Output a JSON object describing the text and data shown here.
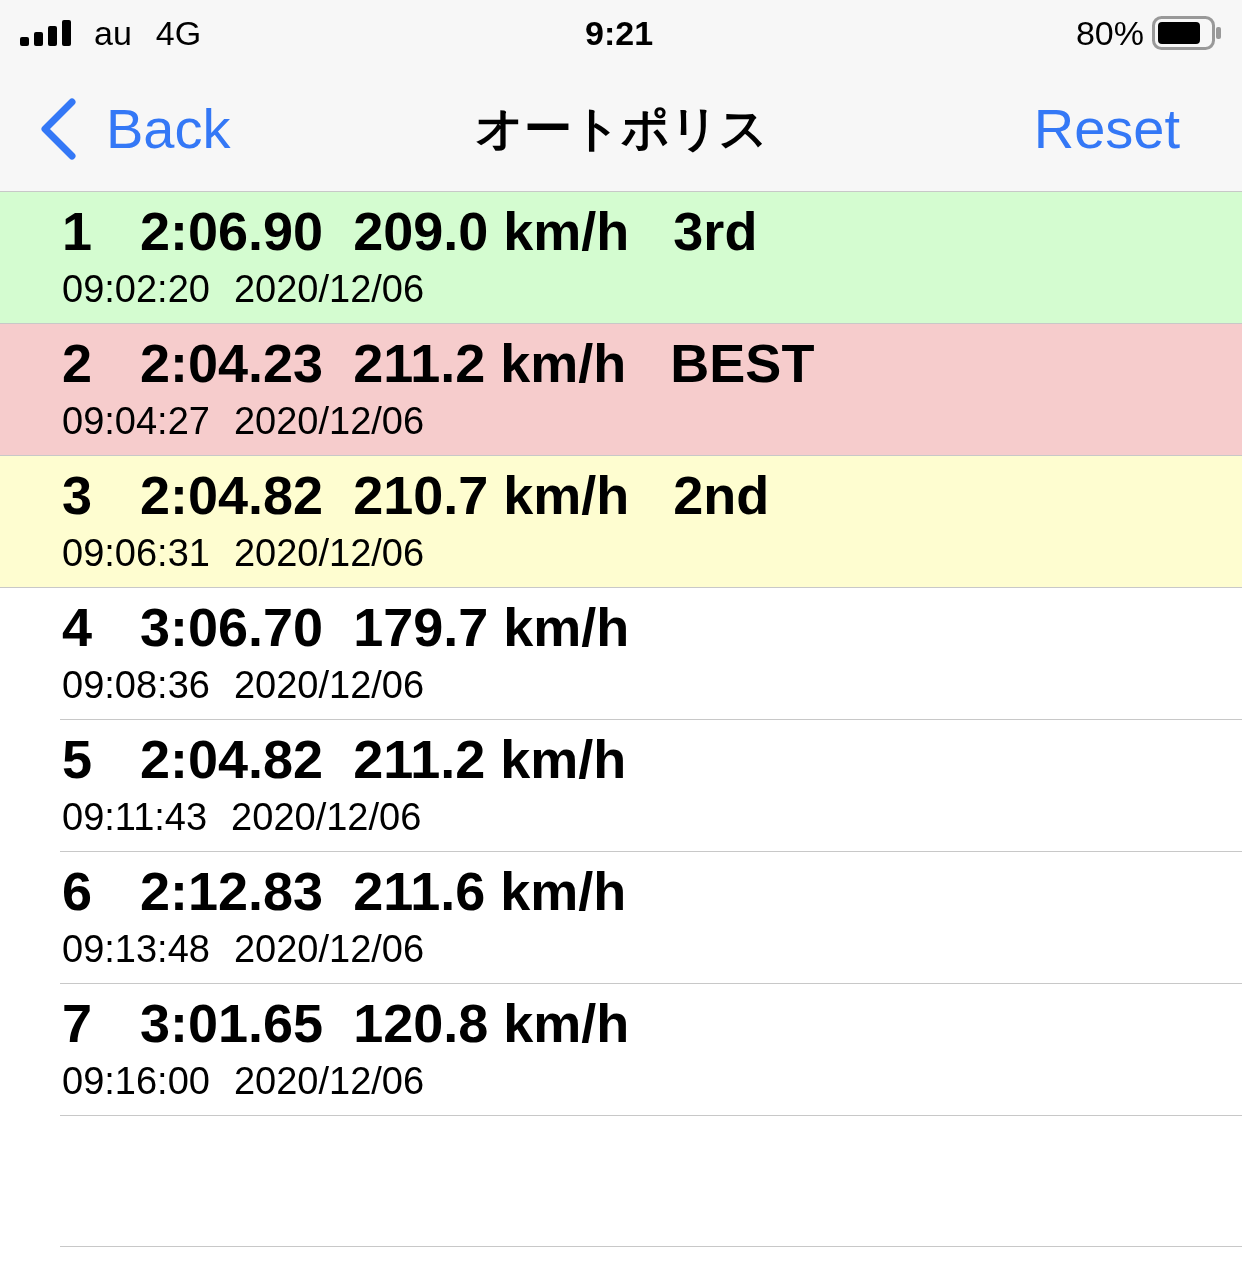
{
  "status_bar": {
    "carrier": "au",
    "network": "4G",
    "time": "9:21",
    "battery": "80%"
  },
  "nav": {
    "back": "Back",
    "title": "オートポリス",
    "action": "Reset"
  },
  "laps": [
    {
      "lap": "1",
      "time": "2:06.90",
      "speed": "209.0 km/h",
      "rank": "3rd",
      "timestamp": "09:02:20",
      "date": "2020/12/06",
      "color": "#d4fcd0"
    },
    {
      "lap": "2",
      "time": "2:04.23",
      "speed": "211.2 km/h",
      "rank": "BEST",
      "timestamp": "09:04:27",
      "date": "2020/12/06",
      "color": "#f6cccc"
    },
    {
      "lap": "3",
      "time": "2:04.82",
      "speed": "210.7 km/h",
      "rank": "2nd",
      "timestamp": "09:06:31",
      "date": "2020/12/06",
      "color": "#fefdd0"
    },
    {
      "lap": "4",
      "time": "3:06.70",
      "speed": "179.7 km/h",
      "timestamp": "09:08:36",
      "date": "2020/12/06"
    },
    {
      "lap": "5",
      "time": "2:04.82",
      "speed": "211.2 km/h",
      "timestamp": "09:11:43",
      "date": "2020/12/06"
    },
    {
      "lap": "6",
      "time": "2:12.83",
      "speed": "211.6 km/h",
      "timestamp": "09:13:48",
      "date": "2020/12/06"
    },
    {
      "lap": "7",
      "time": "3:01.65",
      "speed": "120.8 km/h",
      "timestamp": "09:16:00",
      "date": "2020/12/06"
    }
  ]
}
